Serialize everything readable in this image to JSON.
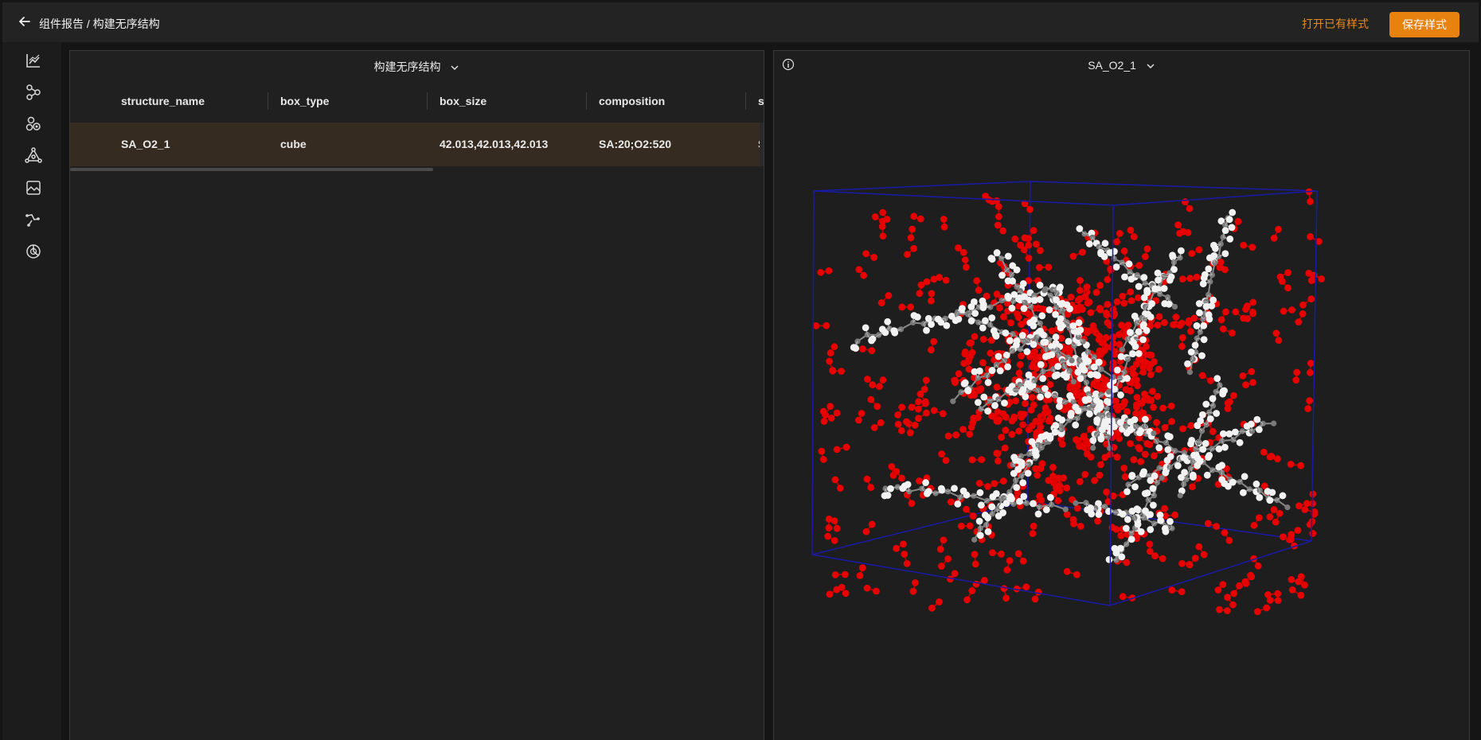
{
  "header": {
    "breadcrumb": "组件报告 / 构建无序结构",
    "open_style_label": "打开已有样式",
    "save_style_label": "保存样式"
  },
  "sidebar": {
    "icons": [
      "line-chart-icon",
      "node-graph-icon",
      "molecule-icon",
      "network-icon",
      "image-icon",
      "path-icon",
      "pie-chart-icon"
    ]
  },
  "left_panel": {
    "title": "构建无序结构",
    "columns": [
      "structure_name",
      "box_type",
      "box_size",
      "composition",
      "st"
    ],
    "rows": [
      [
        "SA_O2_1",
        "cube",
        "42.013,42.013,42.013",
        "SA:20;O2:520",
        "S"
      ]
    ]
  },
  "right_panel": {
    "title": "SA_O2_1",
    "colors": {
      "box": "#1a1aa8",
      "oxygen": "#e60000",
      "hydrogen": "#f2f2f2",
      "carbon": "#7a7a7a"
    }
  },
  "colors": {
    "accent": "#e8820f",
    "row_highlight": "#362b20"
  }
}
